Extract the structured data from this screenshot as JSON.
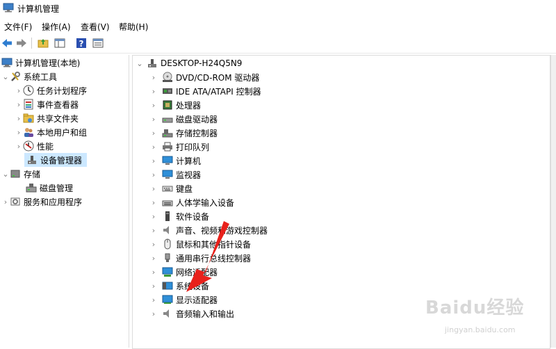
{
  "window": {
    "title": "计算机管理"
  },
  "menu": [
    "文件(F)",
    "操作(A)",
    "查看(V)",
    "帮助(H)"
  ],
  "toolbar": {
    "buttons": [
      "back-arrow-icon",
      "forward-arrow-icon",
      "up-folder-icon",
      "show-hide-tree-icon",
      "help-icon",
      "properties-icon"
    ]
  },
  "left_tree": {
    "root": "计算机管理(本地)",
    "system_tools": "系统工具",
    "task_scheduler": "任务计划程序",
    "event_viewer": "事件查看器",
    "shared_folders": "共享文件夹",
    "local_users": "本地用户和组",
    "performance": "性能",
    "device_manager": "设备管理器",
    "storage": "存储",
    "disk_management": "磁盘管理",
    "services": "服务和应用程序"
  },
  "device_tree": {
    "root": "DESKTOP-H24Q5N9",
    "items": [
      "DVD/CD-ROM 驱动器",
      "IDE ATA/ATAPI 控制器",
      "处理器",
      "磁盘驱动器",
      "存储控制器",
      "打印队列",
      "计算机",
      "监视器",
      "键盘",
      "人体学输入设备",
      "软件设备",
      "声音、视频和游戏控制器",
      "鼠标和其他指针设备",
      "通用串行总线控制器",
      "网络适配器",
      "系统设备",
      "显示适配器",
      "音频输入和输出"
    ]
  },
  "watermark": {
    "brand": "Baidu经验",
    "site": "jingyan.baidu.com"
  },
  "colors": {
    "selection": "#cce8ff",
    "arrow": "#e8211b",
    "monitor": "#2f8fd8"
  }
}
